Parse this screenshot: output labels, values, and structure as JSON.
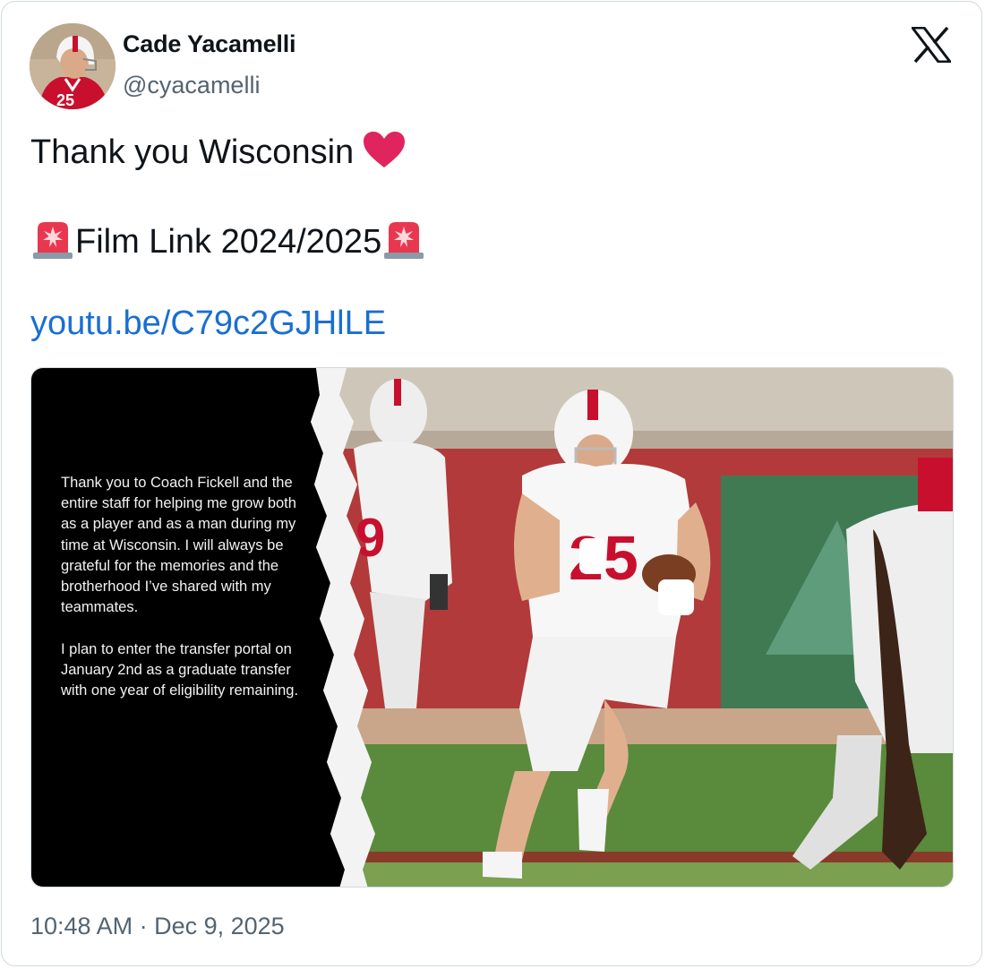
{
  "author": {
    "name": "Cade Yacamelli",
    "handle": "@cyacamelli"
  },
  "tweet": {
    "line1": "Thank you Wisconsin",
    "line2": "Film Link 2024/2025",
    "link": "youtu.be/C79c2GJHlLE"
  },
  "media": {
    "statement": "Thank you to Coach Fickell and the entire staff for helping me grow both as a player and as a man during my time at Wisconsin. I will always be grateful for the memories and the brotherhood I’ve shared with my teammates.\n\nI plan to enter the transfer portal on January 2nd as a graduate transfer with one year of eligibility remaining."
  },
  "meta": {
    "timestamp": "10:48 AM · Dec 9, 2025"
  },
  "icons": {
    "heart": "red-heart-icon",
    "siren": "police-light-icon",
    "logo": "x-logo-icon"
  },
  "colors": {
    "link": "#1a6fd1",
    "heart": "#e0245e",
    "siren": "#e8384f",
    "secondary_text": "#536471"
  }
}
